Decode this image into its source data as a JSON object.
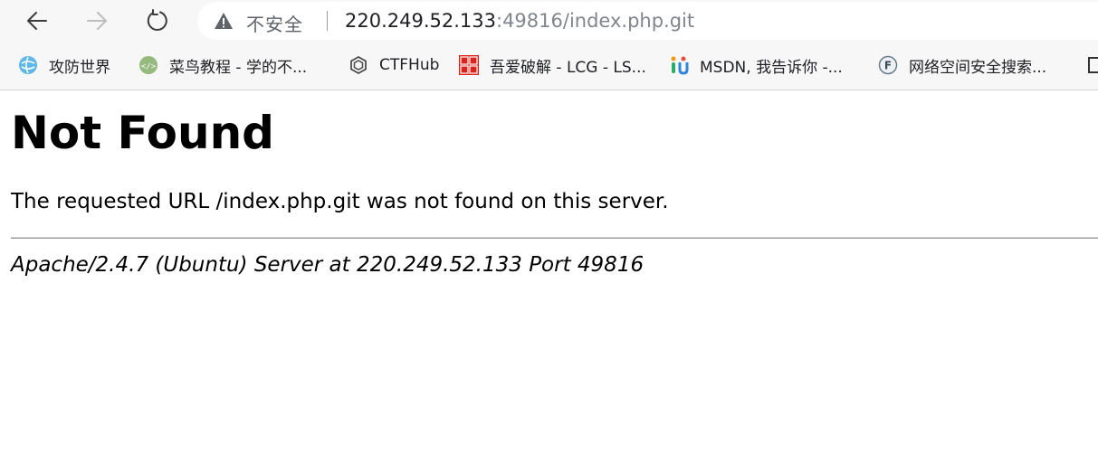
{
  "browser": {
    "address_bar": {
      "security_label": "不安全",
      "url_host": "220.249.52.133",
      "url_rest": ":49816/index.php.git"
    },
    "bookmarks": [
      {
        "label": "攻防世界",
        "icon": "globe-icon"
      },
      {
        "label": "菜鸟教程 - 学的不...",
        "icon": "runoob-icon"
      },
      {
        "label": "CTFHub",
        "icon": "ctfhub-icon"
      },
      {
        "label": "吾爱破解 - LCG - LS...",
        "icon": "52pojie-icon"
      },
      {
        "label": "MSDN, 我告诉你 -...",
        "icon": "msdn-icon"
      },
      {
        "label": "网络空间安全搜索...",
        "icon": "fofa-icon"
      }
    ]
  },
  "page": {
    "title": "Not Found",
    "message": "The requested URL /index.php.git was not found on this server.",
    "server_signature": "Apache/2.4.7 (Ubuntu) Server at 220.249.52.133 Port 49816"
  }
}
